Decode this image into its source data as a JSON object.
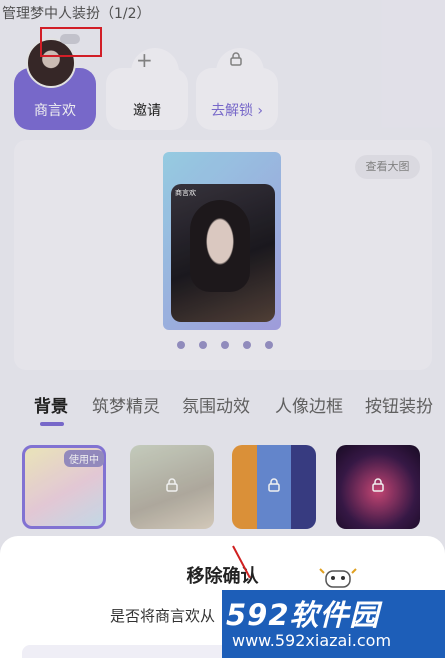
{
  "header": {
    "title": "管理梦中人装扮（1/2）"
  },
  "members": [
    {
      "label": "商言欢"
    },
    {
      "label": "邀请"
    },
    {
      "label": "去解锁"
    }
  ],
  "preview": {
    "view_large_label": "查看大图",
    "phone_name": "商言欢"
  },
  "tabs": [
    {
      "label": "背景"
    },
    {
      "label": "筑梦精灵"
    },
    {
      "label": "氛围动效"
    },
    {
      "label": "人像边框"
    },
    {
      "label": "按钮装扮"
    }
  ],
  "thumbnails": {
    "in_use_badge": "使用中"
  },
  "modal": {
    "title": "移除确认",
    "message": "是否将商言欢从"
  },
  "watermark": {
    "logo": "592软件园",
    "url": "www.592xiazai.com"
  },
  "colors": {
    "accent": "#7f6fd6",
    "selection_box": "#e0202a",
    "watermark_bg": "#1d5eb8"
  }
}
